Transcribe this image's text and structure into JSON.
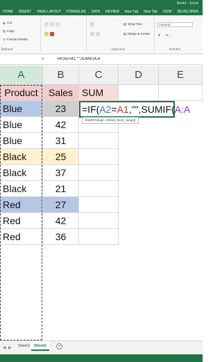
{
  "window": {
    "title": "Book1 - Excel",
    "tabs": [
      "HOME",
      "INSERT",
      "PAGE LAYOUT",
      "FORMULAS",
      "DATA",
      "REVIEW",
      "New Tab",
      "New Tab",
      "VIEW",
      "DEVELOPER"
    ],
    "active_tab": 0
  },
  "ribbon": {
    "cut": "Cut",
    "copy": "Copy",
    "format_painter": "Format Painter",
    "clipboard_group": "lipboard",
    "wrap_text": "Wrap Text",
    "merge_center": "Merge & Center",
    "alignment_group": "Alignment",
    "number_format": "General",
    "number_format_suffix": "$ - % ,",
    "number_group": "Number"
  },
  "formula_bar": {
    "fx": "fx",
    "value": "=IF(A2=A1,\"\",SUMIF(A:A"
  },
  "columns": [
    "A",
    "B",
    "C",
    "D",
    "E"
  ],
  "header_row": {
    "a": "Product",
    "b": "Sales",
    "c": "SUM"
  },
  "rows": [
    {
      "product": "Blue",
      "sales": "23"
    },
    {
      "product": "Blue",
      "sales": "42"
    },
    {
      "product": "Blue",
      "sales": "31"
    },
    {
      "product": "Black",
      "sales": "25"
    },
    {
      "product": "Black",
      "sales": "37"
    },
    {
      "product": "Black",
      "sales": "21"
    },
    {
      "product": "Red",
      "sales": "27"
    },
    {
      "product": "Red",
      "sales": "42"
    },
    {
      "product": "Red",
      "sales": "36"
    }
  ],
  "edit_cell": {
    "p1": "=IF(",
    "ref_a2": "A2",
    "p2": "=",
    "ref_a1": "A1",
    "p3": ",\"\",SUMIF(",
    "ref_aa": "A:A"
  },
  "tooltip": {
    "fn": "SUMIF",
    "args": "(range, criteria, [sum_range])"
  },
  "sheets": [
    "Sheet1",
    "Sheet2"
  ],
  "active_sheet": 1,
  "add_sheet": "+",
  "colors": {
    "accent": "#217346",
    "header_pink": "#f4cccc",
    "blue_row": "#b4c7e7",
    "yellow_row": "#fff2cc"
  }
}
